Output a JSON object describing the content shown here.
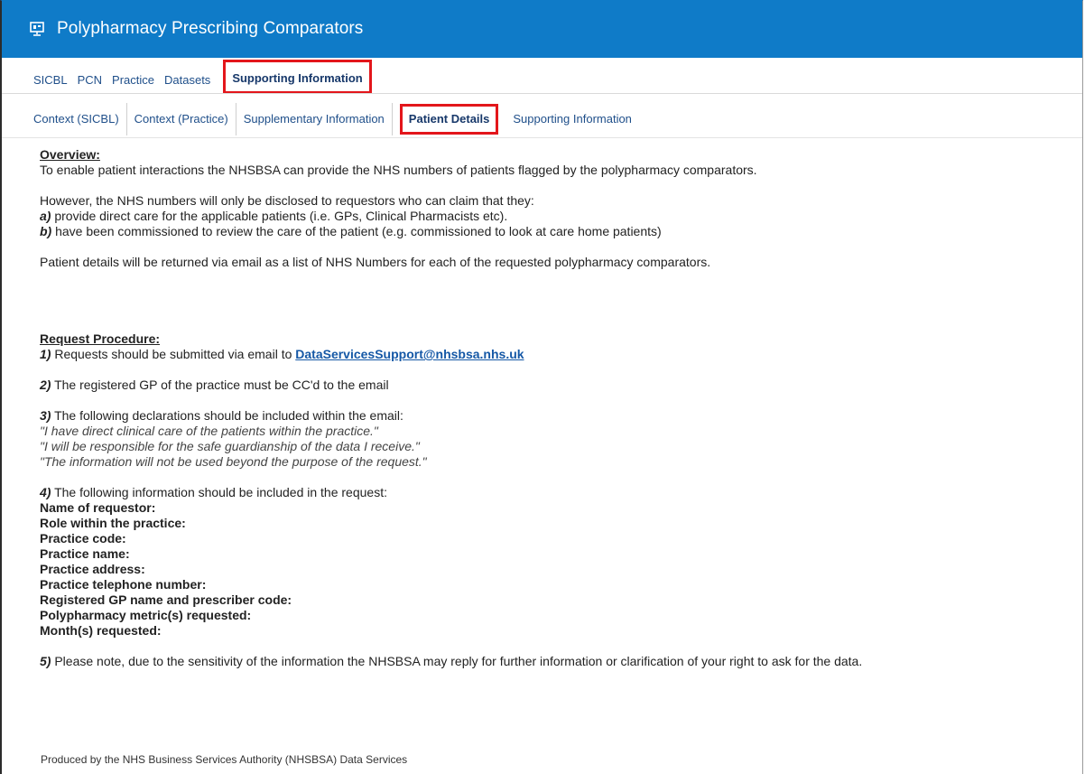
{
  "app": {
    "title": "Polypharmacy Prescribing Comparators",
    "icon": "dashboard-icon",
    "accent_color": "#0f7bc8",
    "highlight_color": "#e3161b"
  },
  "main_tabs": [
    {
      "label": "SICBL",
      "active": false
    },
    {
      "label": "PCN",
      "active": false
    },
    {
      "label": "Practice",
      "active": false
    },
    {
      "label": "Datasets",
      "active": false
    },
    {
      "label": "Supporting Information",
      "active": true
    }
  ],
  "sub_tabs": [
    {
      "label": "Context (SICBL)",
      "active": false
    },
    {
      "label": "Context (Practice)",
      "active": false
    },
    {
      "label": "Supplementary Information",
      "active": false
    },
    {
      "label": "Patient Details",
      "active": true
    },
    {
      "label": "Supporting Information",
      "active": false
    }
  ],
  "overview": {
    "heading": "Overview:",
    "intro": "To enable patient interactions the NHSBSA can provide the NHS numbers of patients flagged by the polypharmacy comparators.",
    "disclosure": "However, the NHS numbers will only be disclosed to requestors who can claim that they:",
    "criteria": [
      {
        "marker": "a)",
        "text": " provide direct care for the applicable patients (i.e. GPs, Clinical Pharmacists etc)."
      },
      {
        "marker": "b)",
        "text": " have been commissioned to review the care of the patient (e.g. commissioned to look at care home patients)"
      }
    ],
    "return_note": "Patient details will be returned via email as a list of NHS Numbers for each of the requested polypharmacy comparators."
  },
  "procedure": {
    "heading": "Request Procedure:",
    "step1": {
      "marker": "1)",
      "text": " Requests should be submitted via email to ",
      "email": "DataServicesSupport@nhsbsa.nhs.uk"
    },
    "step2": {
      "marker": "2)",
      "text": " The registered GP of the practice must be CC'd to the email"
    },
    "step3": {
      "marker": "3)",
      "text": " The following declarations should be included within the email:",
      "declarations": [
        "\"I have direct clinical care of the patients within the practice.\"",
        "\"I will be responsible for the safe guardianship of the data I receive.\"",
        "\"The information will not be used beyond the purpose of the request.\""
      ]
    },
    "step4": {
      "marker": "4)",
      "text": " The following information should be included in the request:",
      "fields": [
        "Name of requestor:",
        "Role within the practice:",
        "Practice code:",
        "Practice name:",
        "Practice address:",
        "Practice telephone number:",
        "Registered GP name and prescriber code:",
        "Polypharmacy metric(s) requested:",
        "Month(s) requested:"
      ]
    },
    "step5": {
      "marker": "5)",
      "text": " Please note, due to the sensitivity of the information the NHSBSA may reply for further information or clarification of your right to ask for the data."
    }
  },
  "footer": "Produced by the NHS Business Services Authority (NHSBSA) Data Services"
}
